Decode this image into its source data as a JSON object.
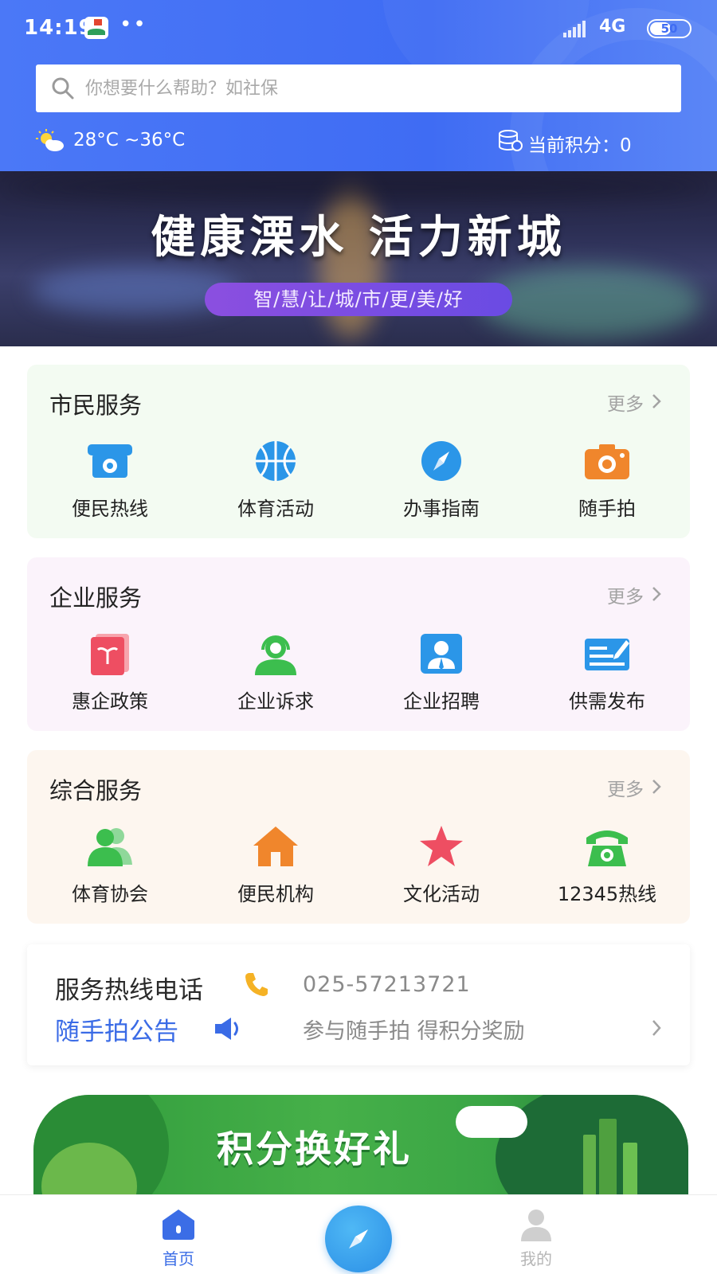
{
  "status_bar": {
    "time": "14:19",
    "dots": "••",
    "network": "4G",
    "battery": "50"
  },
  "search": {
    "placeholder": "你想要什么帮助？如社保"
  },
  "weather": {
    "icon": "sun-cloud-icon",
    "text": "28°C ~36°C"
  },
  "points": {
    "icon": "coins-icon",
    "text": "当前积分：0"
  },
  "banner": {
    "title": "健康溧水  活力新城",
    "subtitle": "智/慧/让/城/市/更/美/好"
  },
  "sections": [
    {
      "title": "市民服务",
      "more": "更多",
      "items": [
        {
          "label": "便民热线",
          "icon": "telephone-icon",
          "color": "#2b96e8"
        },
        {
          "label": "体育活动",
          "icon": "basketball-icon",
          "color": "#2b96e8"
        },
        {
          "label": "办事指南",
          "icon": "compass-icon",
          "color": "#2b96e8"
        },
        {
          "label": "随手拍",
          "icon": "camera-icon",
          "color": "#f0862c"
        }
      ]
    },
    {
      "title": "企业服务",
      "more": "更多",
      "items": [
        {
          "label": "惠企政策",
          "icon": "policy-book-icon",
          "color": "#ee4e62"
        },
        {
          "label": "企业诉求",
          "icon": "headset-person-icon",
          "color": "#3cbe4e"
        },
        {
          "label": "企业招聘",
          "icon": "recruit-person-icon",
          "color": "#2b96e8"
        },
        {
          "label": "供需发布",
          "icon": "publish-form-icon",
          "color": "#2b96e8"
        }
      ]
    },
    {
      "title": "综合服务",
      "more": "更多",
      "items": [
        {
          "label": "体育协会",
          "icon": "group-icon",
          "color": "#3cbe4e"
        },
        {
          "label": "便民机构",
          "icon": "house-icon",
          "color": "#f0862c"
        },
        {
          "label": "文化活动",
          "icon": "star-icon",
          "color": "#ee4e62"
        },
        {
          "label": "12345热线",
          "icon": "phone-line-icon",
          "color": "#3cbe4e"
        }
      ]
    }
  ],
  "hotline": {
    "label": "服务热线电话",
    "number": "025-57213721",
    "notice_label": "随手拍公告",
    "notice_text": "参与随手拍 得积分奖励"
  },
  "promo": {
    "text": "积分换好礼"
  },
  "tabbar": {
    "home": "首页",
    "mine": "我的"
  },
  "colors": {
    "brand_blue": "#3f6cf3",
    "link_blue": "#3a6be6"
  }
}
